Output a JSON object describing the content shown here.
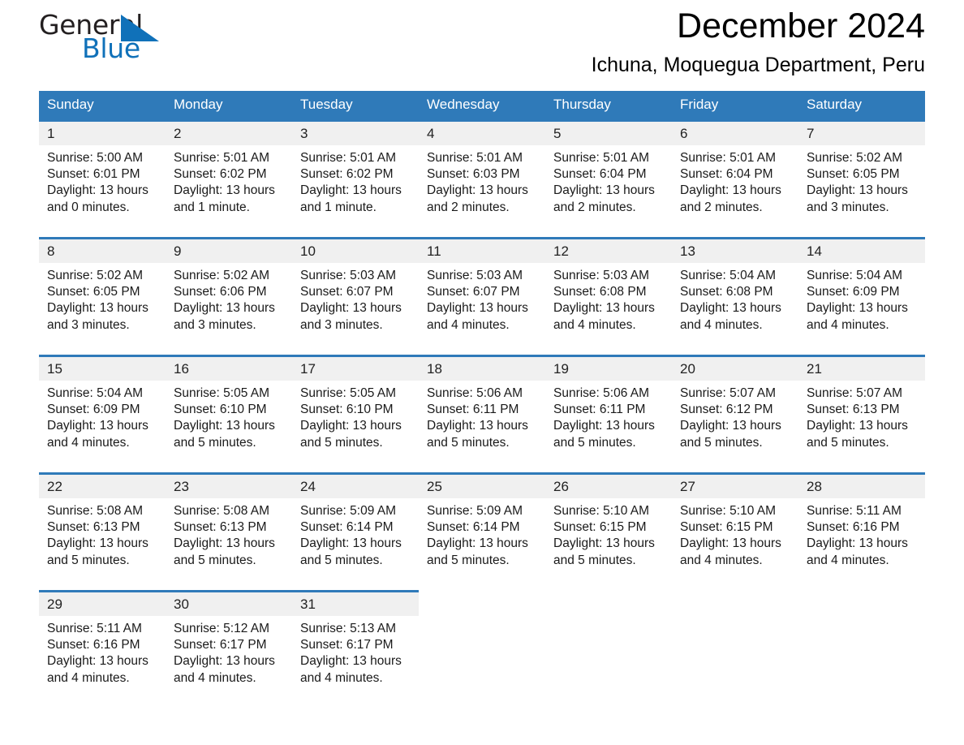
{
  "logo": {
    "word_dark": "General",
    "word_blue": "Blue",
    "triangle_color": "#1071b9",
    "text_color": "#231f20"
  },
  "header": {
    "month_title": "December 2024",
    "location": "Ichuna, Moquegua Department, Peru"
  },
  "theme": {
    "header_blue": "#2f7ab9",
    "daynum_bg": "#f0f0f0",
    "page_bg": "#ffffff"
  },
  "weekdays": [
    "Sunday",
    "Monday",
    "Tuesday",
    "Wednesday",
    "Thursday",
    "Friday",
    "Saturday"
  ],
  "weeks": [
    {
      "days": [
        {
          "num": "1",
          "sunrise": "Sunrise: 5:00 AM",
          "sunset": "Sunset: 6:01 PM",
          "daylight": "Daylight: 13 hours and 0 minutes."
        },
        {
          "num": "2",
          "sunrise": "Sunrise: 5:01 AM",
          "sunset": "Sunset: 6:02 PM",
          "daylight": "Daylight: 13 hours and 1 minute."
        },
        {
          "num": "3",
          "sunrise": "Sunrise: 5:01 AM",
          "sunset": "Sunset: 6:02 PM",
          "daylight": "Daylight: 13 hours and 1 minute."
        },
        {
          "num": "4",
          "sunrise": "Sunrise: 5:01 AM",
          "sunset": "Sunset: 6:03 PM",
          "daylight": "Daylight: 13 hours and 2 minutes."
        },
        {
          "num": "5",
          "sunrise": "Sunrise: 5:01 AM",
          "sunset": "Sunset: 6:04 PM",
          "daylight": "Daylight: 13 hours and 2 minutes."
        },
        {
          "num": "6",
          "sunrise": "Sunrise: 5:01 AM",
          "sunset": "Sunset: 6:04 PM",
          "daylight": "Daylight: 13 hours and 2 minutes."
        },
        {
          "num": "7",
          "sunrise": "Sunrise: 5:02 AM",
          "sunset": "Sunset: 6:05 PM",
          "daylight": "Daylight: 13 hours and 3 minutes."
        }
      ]
    },
    {
      "days": [
        {
          "num": "8",
          "sunrise": "Sunrise: 5:02 AM",
          "sunset": "Sunset: 6:05 PM",
          "daylight": "Daylight: 13 hours and 3 minutes."
        },
        {
          "num": "9",
          "sunrise": "Sunrise: 5:02 AM",
          "sunset": "Sunset: 6:06 PM",
          "daylight": "Daylight: 13 hours and 3 minutes."
        },
        {
          "num": "10",
          "sunrise": "Sunrise: 5:03 AM",
          "sunset": "Sunset: 6:07 PM",
          "daylight": "Daylight: 13 hours and 3 minutes."
        },
        {
          "num": "11",
          "sunrise": "Sunrise: 5:03 AM",
          "sunset": "Sunset: 6:07 PM",
          "daylight": "Daylight: 13 hours and 4 minutes."
        },
        {
          "num": "12",
          "sunrise": "Sunrise: 5:03 AM",
          "sunset": "Sunset: 6:08 PM",
          "daylight": "Daylight: 13 hours and 4 minutes."
        },
        {
          "num": "13",
          "sunrise": "Sunrise: 5:04 AM",
          "sunset": "Sunset: 6:08 PM",
          "daylight": "Daylight: 13 hours and 4 minutes."
        },
        {
          "num": "14",
          "sunrise": "Sunrise: 5:04 AM",
          "sunset": "Sunset: 6:09 PM",
          "daylight": "Daylight: 13 hours and 4 minutes."
        }
      ]
    },
    {
      "days": [
        {
          "num": "15",
          "sunrise": "Sunrise: 5:04 AM",
          "sunset": "Sunset: 6:09 PM",
          "daylight": "Daylight: 13 hours and 4 minutes."
        },
        {
          "num": "16",
          "sunrise": "Sunrise: 5:05 AM",
          "sunset": "Sunset: 6:10 PM",
          "daylight": "Daylight: 13 hours and 5 minutes."
        },
        {
          "num": "17",
          "sunrise": "Sunrise: 5:05 AM",
          "sunset": "Sunset: 6:10 PM",
          "daylight": "Daylight: 13 hours and 5 minutes."
        },
        {
          "num": "18",
          "sunrise": "Sunrise: 5:06 AM",
          "sunset": "Sunset: 6:11 PM",
          "daylight": "Daylight: 13 hours and 5 minutes."
        },
        {
          "num": "19",
          "sunrise": "Sunrise: 5:06 AM",
          "sunset": "Sunset: 6:11 PM",
          "daylight": "Daylight: 13 hours and 5 minutes."
        },
        {
          "num": "20",
          "sunrise": "Sunrise: 5:07 AM",
          "sunset": "Sunset: 6:12 PM",
          "daylight": "Daylight: 13 hours and 5 minutes."
        },
        {
          "num": "21",
          "sunrise": "Sunrise: 5:07 AM",
          "sunset": "Sunset: 6:13 PM",
          "daylight": "Daylight: 13 hours and 5 minutes."
        }
      ]
    },
    {
      "days": [
        {
          "num": "22",
          "sunrise": "Sunrise: 5:08 AM",
          "sunset": "Sunset: 6:13 PM",
          "daylight": "Daylight: 13 hours and 5 minutes."
        },
        {
          "num": "23",
          "sunrise": "Sunrise: 5:08 AM",
          "sunset": "Sunset: 6:13 PM",
          "daylight": "Daylight: 13 hours and 5 minutes."
        },
        {
          "num": "24",
          "sunrise": "Sunrise: 5:09 AM",
          "sunset": "Sunset: 6:14 PM",
          "daylight": "Daylight: 13 hours and 5 minutes."
        },
        {
          "num": "25",
          "sunrise": "Sunrise: 5:09 AM",
          "sunset": "Sunset: 6:14 PM",
          "daylight": "Daylight: 13 hours and 5 minutes."
        },
        {
          "num": "26",
          "sunrise": "Sunrise: 5:10 AM",
          "sunset": "Sunset: 6:15 PM",
          "daylight": "Daylight: 13 hours and 5 minutes."
        },
        {
          "num": "27",
          "sunrise": "Sunrise: 5:10 AM",
          "sunset": "Sunset: 6:15 PM",
          "daylight": "Daylight: 13 hours and 4 minutes."
        },
        {
          "num": "28",
          "sunrise": "Sunrise: 5:11 AM",
          "sunset": "Sunset: 6:16 PM",
          "daylight": "Daylight: 13 hours and 4 minutes."
        }
      ]
    },
    {
      "days": [
        {
          "num": "29",
          "sunrise": "Sunrise: 5:11 AM",
          "sunset": "Sunset: 6:16 PM",
          "daylight": "Daylight: 13 hours and 4 minutes."
        },
        {
          "num": "30",
          "sunrise": "Sunrise: 5:12 AM",
          "sunset": "Sunset: 6:17 PM",
          "daylight": "Daylight: 13 hours and 4 minutes."
        },
        {
          "num": "31",
          "sunrise": "Sunrise: 5:13 AM",
          "sunset": "Sunset: 6:17 PM",
          "daylight": "Daylight: 13 hours and 4 minutes."
        },
        {
          "num": "",
          "sunrise": "",
          "sunset": "",
          "daylight": ""
        },
        {
          "num": "",
          "sunrise": "",
          "sunset": "",
          "daylight": ""
        },
        {
          "num": "",
          "sunrise": "",
          "sunset": "",
          "daylight": ""
        },
        {
          "num": "",
          "sunrise": "",
          "sunset": "",
          "daylight": ""
        }
      ]
    }
  ]
}
